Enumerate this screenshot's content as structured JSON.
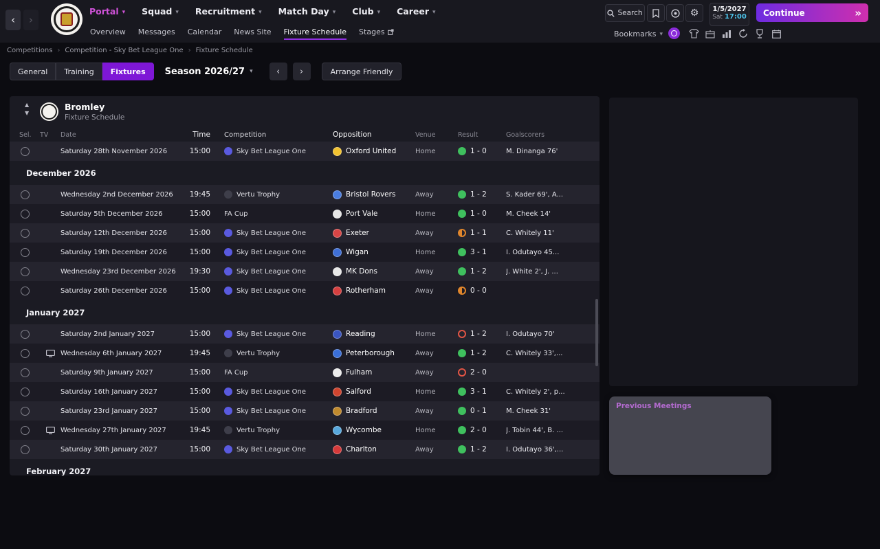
{
  "top_nav": {
    "menus": [
      {
        "label": "Portal",
        "active": true
      },
      {
        "label": "Squad",
        "active": false
      },
      {
        "label": "Recruitment",
        "active": false
      },
      {
        "label": "Match Day",
        "active": false
      },
      {
        "label": "Club",
        "active": false
      },
      {
        "label": "Career",
        "active": false
      }
    ],
    "search_placeholder": "Search",
    "date_line1": "1/5/2027",
    "date_day": "Sat",
    "date_time": "17:00",
    "continue_label": "Continue",
    "continue_arrows": "»"
  },
  "sub_nav": {
    "items": [
      {
        "label": "Overview",
        "active": false,
        "external": false
      },
      {
        "label": "Messages",
        "active": false,
        "external": false
      },
      {
        "label": "Calendar",
        "active": false,
        "external": false
      },
      {
        "label": "News Site",
        "active": false,
        "external": false
      },
      {
        "label": "Fixture Schedule",
        "active": true,
        "external": false
      },
      {
        "label": "Stages",
        "active": false,
        "external": true
      }
    ],
    "bookmarks_label": "Bookmarks"
  },
  "breadcrumb": {
    "items": [
      "Competitions",
      "Competition - Sky Bet League One",
      "Fixture Schedule"
    ]
  },
  "toolbar": {
    "tabs": [
      {
        "label": "General",
        "active": false
      },
      {
        "label": "Training",
        "active": false
      },
      {
        "label": "Fixtures",
        "active": true
      }
    ],
    "season_label": "Season 2026/27",
    "arrange_friendly_label": "Arrange Friendly"
  },
  "fixture_panel": {
    "club_name": "Bromley",
    "subtitle": "Fixture Schedule",
    "columns": [
      "Sel.",
      "TV",
      "Date",
      "Time",
      "Competition",
      "Opposition",
      "Venue",
      "Result",
      "Goalscorers"
    ],
    "rows": [
      {
        "type": "fixture",
        "tv": false,
        "date": "Saturday 28th November 2026",
        "time": "15:00",
        "competition": "Sky Bet League One",
        "comp_icon": "#5a5adf",
        "opposition": "Oxford United",
        "badge": "#f2c230",
        "venue": "Home",
        "result": "1 - 0",
        "outcome": "win",
        "scorers": "M. Dinanga 76'"
      },
      {
        "type": "month",
        "label": "December 2026"
      },
      {
        "type": "fixture",
        "tv": false,
        "date": "Wednesday 2nd December 2026",
        "time": "19:45",
        "competition": "Vertu Trophy",
        "comp_icon": "#3e3e4a",
        "opposition": "Bristol Rovers",
        "badge": "#4a7de0",
        "venue": "Away",
        "result": "1 - 2",
        "outcome": "win",
        "scorers": "S. Kader 69', A..."
      },
      {
        "type": "fixture",
        "tv": false,
        "date": "Saturday 5th December 2026",
        "time": "15:00",
        "competition": "FA Cup",
        "comp_icon": null,
        "opposition": "Port Vale",
        "badge": "#e6e6e6",
        "venue": "Home",
        "result": "1 - 0",
        "outcome": "win",
        "scorers": "M. Cheek 14'"
      },
      {
        "type": "fixture",
        "tv": false,
        "date": "Saturday 12th December 2026",
        "time": "15:00",
        "competition": "Sky Bet League One",
        "comp_icon": "#5a5adf",
        "opposition": "Exeter",
        "badge": "#d84545",
        "venue": "Away",
        "result": "1 - 1",
        "outcome": "draw",
        "scorers": "C. Whitely 11'"
      },
      {
        "type": "fixture",
        "tv": false,
        "date": "Saturday 19th December 2026",
        "time": "15:00",
        "competition": "Sky Bet League One",
        "comp_icon": "#5a5adf",
        "opposition": "Wigan",
        "badge": "#3f6fd6",
        "venue": "Home",
        "result": "3 - 1",
        "outcome": "win",
        "scorers": "I. Odutayo 45..."
      },
      {
        "type": "fixture",
        "tv": false,
        "date": "Wednesday 23rd December 2026",
        "time": "19:30",
        "competition": "Sky Bet League One",
        "comp_icon": "#5a5adf",
        "opposition": "MK Dons",
        "badge": "#e8e8e8",
        "venue": "Away",
        "result": "1 - 2",
        "outcome": "win",
        "scorers": "J. White 2', J. ..."
      },
      {
        "type": "fixture",
        "tv": false,
        "date": "Saturday 26th December 2026",
        "time": "15:00",
        "competition": "Sky Bet League One",
        "comp_icon": "#5a5adf",
        "opposition": "Rotherham",
        "badge": "#d64040",
        "venue": "Away",
        "result": "0 - 0",
        "outcome": "draw",
        "scorers": ""
      },
      {
        "type": "month",
        "label": "January 2027"
      },
      {
        "type": "fixture",
        "tv": false,
        "date": "Saturday 2nd January 2027",
        "time": "15:00",
        "competition": "Sky Bet League One",
        "comp_icon": "#5a5adf",
        "opposition": "Reading",
        "badge": "#3a55c0",
        "venue": "Home",
        "result": "1 - 2",
        "outcome": "loss",
        "scorers": "I. Odutayo 70'"
      },
      {
        "type": "fixture",
        "tv": true,
        "date": "Wednesday 6th January 2027",
        "time": "19:45",
        "competition": "Vertu Trophy",
        "comp_icon": "#3e3e4a",
        "opposition": "Peterborough",
        "badge": "#3a6fd8",
        "venue": "Away",
        "result": "1 - 2",
        "outcome": "win",
        "scorers": "C. Whitely 33',..."
      },
      {
        "type": "fixture",
        "tv": false,
        "date": "Saturday 9th January 2027",
        "time": "15:00",
        "competition": "FA Cup",
        "comp_icon": null,
        "opposition": "Fulham",
        "badge": "#ececec",
        "venue": "Away",
        "result": "2 - 0",
        "outcome": "loss",
        "scorers": ""
      },
      {
        "type": "fixture",
        "tv": false,
        "date": "Saturday 16th January 2027",
        "time": "15:00",
        "competition": "Sky Bet League One",
        "comp_icon": "#5a5adf",
        "opposition": "Salford",
        "badge": "#d0452f",
        "venue": "Home",
        "result": "3 - 1",
        "outcome": "win",
        "scorers": "C. Whitely 2', p..."
      },
      {
        "type": "fixture",
        "tv": false,
        "date": "Saturday 23rd January 2027",
        "time": "15:00",
        "competition": "Sky Bet League One",
        "comp_icon": "#5a5adf",
        "opposition": "Bradford",
        "badge": "#c08a2e",
        "venue": "Away",
        "result": "0 - 1",
        "outcome": "win",
        "scorers": "M. Cheek 31'"
      },
      {
        "type": "fixture",
        "tv": true,
        "date": "Wednesday 27th January 2027",
        "time": "19:45",
        "competition": "Vertu Trophy",
        "comp_icon": "#3e3e4a",
        "opposition": "Wycombe",
        "badge": "#58a8dc",
        "venue": "Home",
        "result": "2 - 0",
        "outcome": "win",
        "scorers": "J. Tobin 44', B. ..."
      },
      {
        "type": "fixture",
        "tv": false,
        "date": "Saturday 30th January 2027",
        "time": "15:00",
        "competition": "Sky Bet League One",
        "comp_icon": "#5a5adf",
        "opposition": "Charlton",
        "badge": "#d63a3a",
        "venue": "Away",
        "result": "1 - 2",
        "outcome": "win",
        "scorers": "I. Odutayo 36',..."
      },
      {
        "type": "month",
        "label": "February 2027"
      }
    ]
  },
  "side": {
    "previous_meetings_title": "Previous Meetings"
  },
  "colors": {
    "accent": "#7e17d6",
    "win": "#3fc05e",
    "draw": "#e0862c",
    "loss": "#e25545"
  }
}
